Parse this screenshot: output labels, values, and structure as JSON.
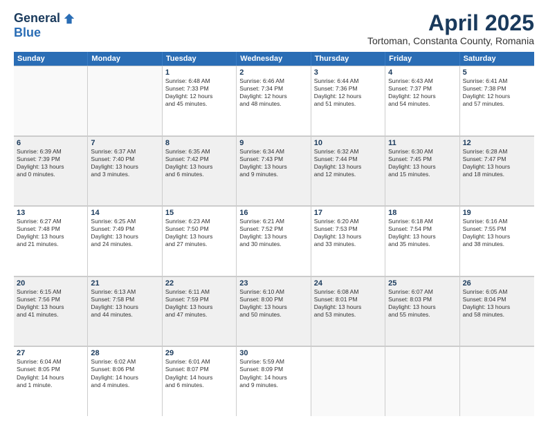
{
  "header": {
    "logo_general": "General",
    "logo_blue": "Blue",
    "month_title": "April 2025",
    "subtitle": "Tortoman, Constanta County, Romania"
  },
  "days_of_week": [
    "Sunday",
    "Monday",
    "Tuesday",
    "Wednesday",
    "Thursday",
    "Friday",
    "Saturday"
  ],
  "weeks": [
    [
      {
        "day": "",
        "lines": [],
        "empty": true
      },
      {
        "day": "",
        "lines": [],
        "empty": true
      },
      {
        "day": "1",
        "lines": [
          "Sunrise: 6:48 AM",
          "Sunset: 7:33 PM",
          "Daylight: 12 hours",
          "and 45 minutes."
        ]
      },
      {
        "day": "2",
        "lines": [
          "Sunrise: 6:46 AM",
          "Sunset: 7:34 PM",
          "Daylight: 12 hours",
          "and 48 minutes."
        ]
      },
      {
        "day": "3",
        "lines": [
          "Sunrise: 6:44 AM",
          "Sunset: 7:36 PM",
          "Daylight: 12 hours",
          "and 51 minutes."
        ]
      },
      {
        "day": "4",
        "lines": [
          "Sunrise: 6:43 AM",
          "Sunset: 7:37 PM",
          "Daylight: 12 hours",
          "and 54 minutes."
        ]
      },
      {
        "day": "5",
        "lines": [
          "Sunrise: 6:41 AM",
          "Sunset: 7:38 PM",
          "Daylight: 12 hours",
          "and 57 minutes."
        ]
      }
    ],
    [
      {
        "day": "6",
        "lines": [
          "Sunrise: 6:39 AM",
          "Sunset: 7:39 PM",
          "Daylight: 13 hours",
          "and 0 minutes."
        ],
        "shaded": true
      },
      {
        "day": "7",
        "lines": [
          "Sunrise: 6:37 AM",
          "Sunset: 7:40 PM",
          "Daylight: 13 hours",
          "and 3 minutes."
        ],
        "shaded": true
      },
      {
        "day": "8",
        "lines": [
          "Sunrise: 6:35 AM",
          "Sunset: 7:42 PM",
          "Daylight: 13 hours",
          "and 6 minutes."
        ],
        "shaded": true
      },
      {
        "day": "9",
        "lines": [
          "Sunrise: 6:34 AM",
          "Sunset: 7:43 PM",
          "Daylight: 13 hours",
          "and 9 minutes."
        ],
        "shaded": true
      },
      {
        "day": "10",
        "lines": [
          "Sunrise: 6:32 AM",
          "Sunset: 7:44 PM",
          "Daylight: 13 hours",
          "and 12 minutes."
        ],
        "shaded": true
      },
      {
        "day": "11",
        "lines": [
          "Sunrise: 6:30 AM",
          "Sunset: 7:45 PM",
          "Daylight: 13 hours",
          "and 15 minutes."
        ],
        "shaded": true
      },
      {
        "day": "12",
        "lines": [
          "Sunrise: 6:28 AM",
          "Sunset: 7:47 PM",
          "Daylight: 13 hours",
          "and 18 minutes."
        ],
        "shaded": true
      }
    ],
    [
      {
        "day": "13",
        "lines": [
          "Sunrise: 6:27 AM",
          "Sunset: 7:48 PM",
          "Daylight: 13 hours",
          "and 21 minutes."
        ]
      },
      {
        "day": "14",
        "lines": [
          "Sunrise: 6:25 AM",
          "Sunset: 7:49 PM",
          "Daylight: 13 hours",
          "and 24 minutes."
        ]
      },
      {
        "day": "15",
        "lines": [
          "Sunrise: 6:23 AM",
          "Sunset: 7:50 PM",
          "Daylight: 13 hours",
          "and 27 minutes."
        ]
      },
      {
        "day": "16",
        "lines": [
          "Sunrise: 6:21 AM",
          "Sunset: 7:52 PM",
          "Daylight: 13 hours",
          "and 30 minutes."
        ]
      },
      {
        "day": "17",
        "lines": [
          "Sunrise: 6:20 AM",
          "Sunset: 7:53 PM",
          "Daylight: 13 hours",
          "and 33 minutes."
        ]
      },
      {
        "day": "18",
        "lines": [
          "Sunrise: 6:18 AM",
          "Sunset: 7:54 PM",
          "Daylight: 13 hours",
          "and 35 minutes."
        ]
      },
      {
        "day": "19",
        "lines": [
          "Sunrise: 6:16 AM",
          "Sunset: 7:55 PM",
          "Daylight: 13 hours",
          "and 38 minutes."
        ]
      }
    ],
    [
      {
        "day": "20",
        "lines": [
          "Sunrise: 6:15 AM",
          "Sunset: 7:56 PM",
          "Daylight: 13 hours",
          "and 41 minutes."
        ],
        "shaded": true
      },
      {
        "day": "21",
        "lines": [
          "Sunrise: 6:13 AM",
          "Sunset: 7:58 PM",
          "Daylight: 13 hours",
          "and 44 minutes."
        ],
        "shaded": true
      },
      {
        "day": "22",
        "lines": [
          "Sunrise: 6:11 AM",
          "Sunset: 7:59 PM",
          "Daylight: 13 hours",
          "and 47 minutes."
        ],
        "shaded": true
      },
      {
        "day": "23",
        "lines": [
          "Sunrise: 6:10 AM",
          "Sunset: 8:00 PM",
          "Daylight: 13 hours",
          "and 50 minutes."
        ],
        "shaded": true
      },
      {
        "day": "24",
        "lines": [
          "Sunrise: 6:08 AM",
          "Sunset: 8:01 PM",
          "Daylight: 13 hours",
          "and 53 minutes."
        ],
        "shaded": true
      },
      {
        "day": "25",
        "lines": [
          "Sunrise: 6:07 AM",
          "Sunset: 8:03 PM",
          "Daylight: 13 hours",
          "and 55 minutes."
        ],
        "shaded": true
      },
      {
        "day": "26",
        "lines": [
          "Sunrise: 6:05 AM",
          "Sunset: 8:04 PM",
          "Daylight: 13 hours",
          "and 58 minutes."
        ],
        "shaded": true
      }
    ],
    [
      {
        "day": "27",
        "lines": [
          "Sunrise: 6:04 AM",
          "Sunset: 8:05 PM",
          "Daylight: 14 hours",
          "and 1 minute."
        ]
      },
      {
        "day": "28",
        "lines": [
          "Sunrise: 6:02 AM",
          "Sunset: 8:06 PM",
          "Daylight: 14 hours",
          "and 4 minutes."
        ]
      },
      {
        "day": "29",
        "lines": [
          "Sunrise: 6:01 AM",
          "Sunset: 8:07 PM",
          "Daylight: 14 hours",
          "and 6 minutes."
        ]
      },
      {
        "day": "30",
        "lines": [
          "Sunrise: 5:59 AM",
          "Sunset: 8:09 PM",
          "Daylight: 14 hours",
          "and 9 minutes."
        ]
      },
      {
        "day": "",
        "lines": [],
        "empty": true
      },
      {
        "day": "",
        "lines": [],
        "empty": true
      },
      {
        "day": "",
        "lines": [],
        "empty": true
      }
    ]
  ]
}
